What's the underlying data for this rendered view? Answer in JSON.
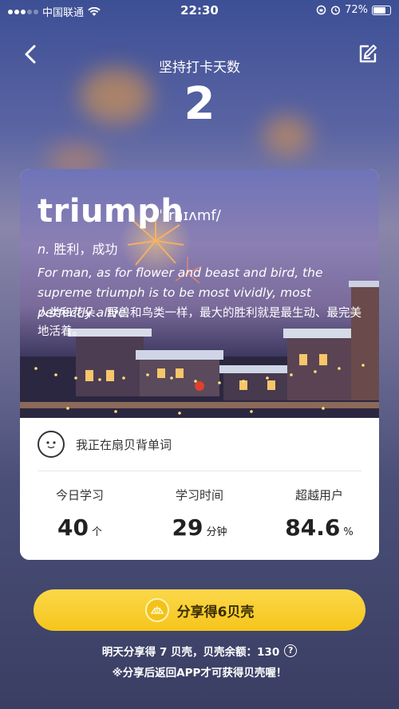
{
  "status_bar": {
    "carrier": "中国联通",
    "time": "22:30",
    "battery": "72%"
  },
  "header": {
    "title": "坚持打卡天数",
    "days": "2"
  },
  "card": {
    "word": "triumph",
    "phonetic": "/ˈtraɪʌmf/",
    "pos": "n.",
    "meaning": "胜利，成功",
    "sentence_en": "For man, as for flower and beast and bird, the supreme triumph is to be most vividly, most perfectly alive.",
    "sentence_zh": "人类和花朵、野兽和鸟类一样，最大的胜利就是最生动、最完美地活着。",
    "app_text": "我正在扇贝背单词",
    "stats": [
      {
        "label": "今日学习",
        "value": "40",
        "unit": "个"
      },
      {
        "label": "学习时间",
        "value": "29",
        "unit": "分钟"
      },
      {
        "label": "超越用户",
        "value": "84.6",
        "unit": "%"
      }
    ]
  },
  "share": {
    "button_label": "分享得6贝壳",
    "note_line1": "明天分享得 7 贝壳，贝壳余额：130",
    "note_line2": "※分享后返回APP才可获得贝壳喔！"
  },
  "colors": {
    "accent": "#f6c51c",
    "background_top": "#3d4f95",
    "background_bottom": "#3a3e63"
  }
}
